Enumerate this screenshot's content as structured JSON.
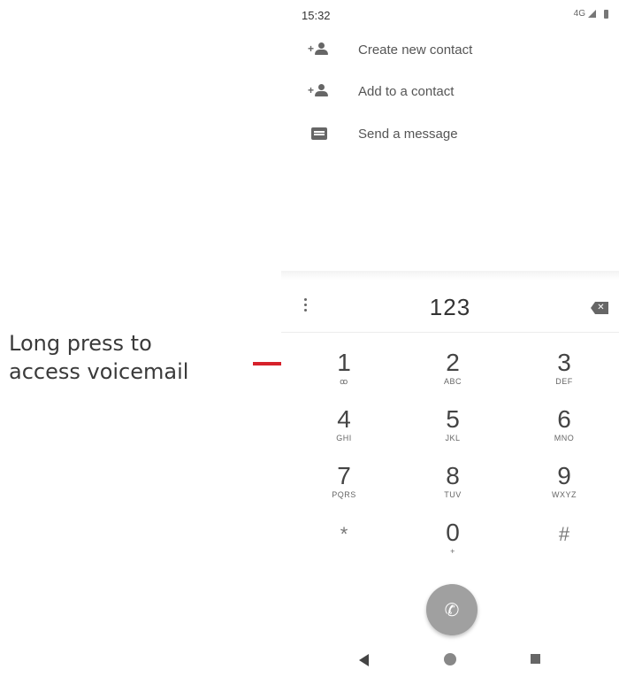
{
  "annotation": {
    "line1": "Long press to",
    "line2": "access voicemail",
    "line_color": "#d6212b"
  },
  "status_bar": {
    "time": "15:32",
    "network": "4G"
  },
  "actions": [
    {
      "label": "Create new contact",
      "icon": "person-add-icon"
    },
    {
      "label": "Add to a contact",
      "icon": "person-add-icon"
    },
    {
      "label": "Send a message",
      "icon": "message-icon"
    }
  ],
  "dialer": {
    "number": "123",
    "keys": [
      {
        "digit": "1",
        "letters": "ꝏ"
      },
      {
        "digit": "2",
        "letters": "ABC"
      },
      {
        "digit": "3",
        "letters": "DEF"
      },
      {
        "digit": "4",
        "letters": "GHI"
      },
      {
        "digit": "5",
        "letters": "JKL"
      },
      {
        "digit": "6",
        "letters": "MNO"
      },
      {
        "digit": "7",
        "letters": "PQRS"
      },
      {
        "digit": "8",
        "letters": "TUV"
      },
      {
        "digit": "9",
        "letters": "WXYZ"
      },
      {
        "digit": "*",
        "letters": ""
      },
      {
        "digit": "0",
        "letters": "+"
      },
      {
        "digit": "#",
        "letters": ""
      }
    ]
  },
  "colors": {
    "call_button": "#a0a0a0"
  }
}
